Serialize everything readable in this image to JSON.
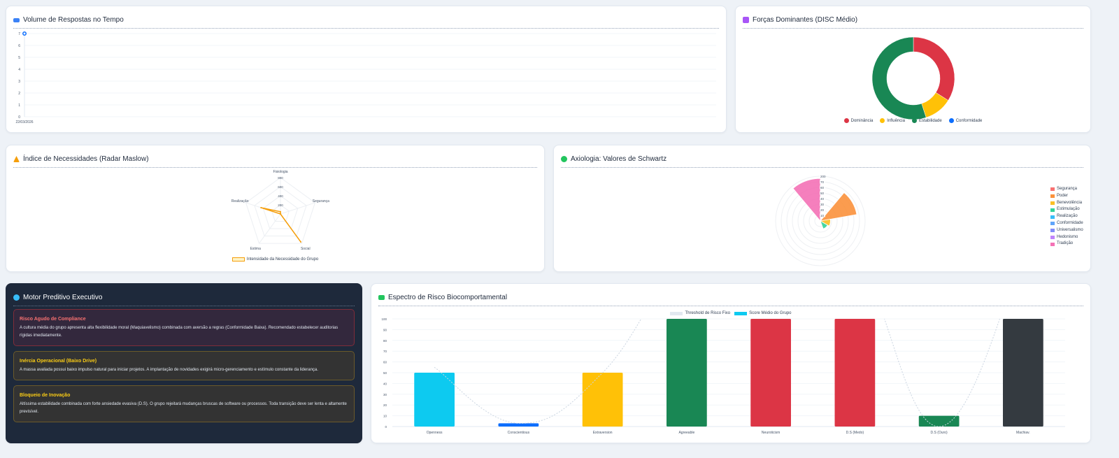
{
  "cards": {
    "volume": {
      "title": "Volume de Respostas no Tempo",
      "icon": "chart-line-icon"
    },
    "disc": {
      "title": "Forças Dominantes (DISC Médio)",
      "icon": "puzzle-icon"
    },
    "maslow": {
      "title": "Índice de Necessidades (Radar Maslow)",
      "icon": "warning-triangle-icon"
    },
    "schwartz": {
      "title": "Axiologia: Valores de Schwartz",
      "icon": "compass-icon"
    },
    "motor": {
      "title": "Motor Preditivo Executivo",
      "icon": "brain-icon"
    },
    "risco": {
      "title": "Espectro de Risco Biocomportamental",
      "icon": "chart-area-icon"
    }
  },
  "alerts": [
    {
      "title": "Risco Agudo de Compliance",
      "text": "A cultura média do grupo apresenta alta flexibilidade moral (Maquiavelismo) combinada com aversão a regras (Conformidade Baixa). Recomendado estabelecer auditorias rígidas imediatamente.",
      "color": "#f87171",
      "bg": "#33283d",
      "border": "#7f2d3a"
    },
    {
      "title": "Inércia Operacional (Baixo Drive)",
      "text": "A massa avaliada possui baixo impulso natural para iniciar projetos. A implantação de novidades exigirá micro-gerenciamento e estímulo constante da liderança.",
      "color": "#facc15",
      "bg": "#333333",
      "border": "#6b5a2a"
    },
    {
      "title": "Bloqueio de Inovação",
      "text": "Altíssima estabilidade combinada com forte ansiedade evasiva (D.S). O grupo rejeitará mudanças bruscas de software ou processos. Toda transição deve ser lenta e altamente previsível.",
      "color": "#facc15",
      "bg": "#333333",
      "border": "#6b5a2a"
    }
  ],
  "chart_data": [
    {
      "type": "line",
      "id": "volume",
      "categories": [
        "22/03/2026"
      ],
      "values": [
        7
      ],
      "ylim": [
        0,
        7
      ],
      "yticks": [
        "0",
        "1",
        "2",
        "3",
        "4",
        "5",
        "6",
        "7"
      ],
      "color": "#0d6efd",
      "grid": true
    },
    {
      "type": "pie",
      "id": "disc",
      "donut": true,
      "labels": [
        "Dominância",
        "Influência",
        "Estabilidade",
        "Conformidade"
      ],
      "values": [
        34,
        11,
        55,
        0
      ],
      "colors": [
        "#dc3545",
        "#ffc107",
        "#198754",
        "#0d6efd"
      ],
      "legend": "bottom"
    },
    {
      "type": "radar",
      "id": "maslow",
      "labels": [
        "Fisiologia",
        "Segurança",
        "Social",
        "Estima",
        "Realização"
      ],
      "values": [
        50,
        0,
        760,
        0,
        450
      ],
      "rlim": [
        0,
        800
      ],
      "ticks": [
        "200",
        "400",
        "600",
        "800"
      ],
      "series_name": "Intensidade da Necessidade do Grupo",
      "color": "#f59e0b",
      "legend": "bottom"
    },
    {
      "type": "polarArea",
      "id": "schwartz",
      "labels": [
        "Segurança",
        "Poder",
        "Benevolência",
        "Estimulação",
        "Realização",
        "Conformidade",
        "Universalismo",
        "Hedonismo",
        "Tradição"
      ],
      "values": [
        0,
        66,
        18,
        15,
        0,
        0,
        0,
        0,
        76
      ],
      "rlim": [
        0,
        80
      ],
      "ticks": [
        "10",
        "20",
        "30",
        "40",
        "50",
        "60",
        "70",
        "200"
      ],
      "colors": [
        "#f87171",
        "#fb923c",
        "#fbbf24",
        "#34d399",
        "#38bdf8",
        "#60a5fa",
        "#818cf8",
        "#c084fc",
        "#f472b6"
      ],
      "legend": "right"
    },
    {
      "type": "bar",
      "id": "risco",
      "categories": [
        "Openness",
        "Conscientious",
        "Extraversion",
        "Agreeable",
        "Neuroticism",
        "D.S (Medo)",
        "D.S (Ouro)",
        "Machiav."
      ],
      "series": [
        {
          "name": "Score Médio do Grupo",
          "values": [
            50,
            3,
            50,
            100,
            100,
            100,
            10,
            100
          ],
          "colors": [
            "#0dcaf0",
            "#0d6efd",
            "#ffc107",
            "#198754",
            "#dc3545",
            "#dc3545",
            "#198754",
            "#343a40"
          ]
        },
        {
          "name": "Threshold de Risco Fixo",
          "values": [
            55,
            3,
            50,
            160,
            200,
            160,
            0,
            160
          ],
          "color": "#cbd5e1",
          "style": "dashed-line"
        }
      ],
      "ylim": [
        0,
        100
      ],
      "yticks": [
        "0",
        "10",
        "20",
        "30",
        "40",
        "50",
        "60",
        "70",
        "80",
        "90",
        "100"
      ],
      "legend": "top",
      "grid": true
    }
  ]
}
